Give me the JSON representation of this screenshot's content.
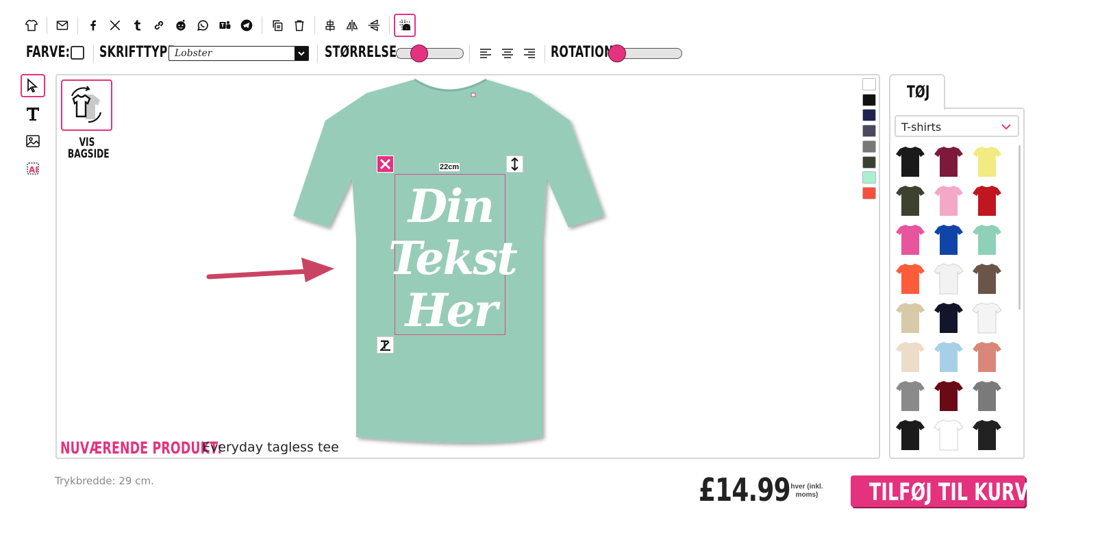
{
  "toolbar_top": {
    "icons": [
      "tshirt-icon",
      "mail-icon",
      "facebook-icon",
      "x-icon",
      "tumblr-icon",
      "pinterest-icon",
      "reddit-icon",
      "whatsapp-icon",
      "teams-icon",
      "telegram-icon",
      "copy-icon",
      "trash-icon",
      "align-center-icon",
      "flip-horizontal-icon",
      "flip-vertical-icon",
      "grid-helmet-icon"
    ]
  },
  "toolbar_format": {
    "color_label": "FARVE:",
    "font_label": "SKRIFTTYPE:",
    "font_value": "Lobster",
    "size_label": "STØRRELSE:",
    "size_value_fraction": 0.28,
    "rotation_label": "ROTATION:",
    "rotation_value_fraction": 0.0
  },
  "tools": [
    "pointer-icon",
    "text-icon",
    "image-icon",
    "ai-icon"
  ],
  "canvas": {
    "show_back_label_1": "VIS",
    "show_back_label_2": "BAGSIDE",
    "design_text_lines": [
      "Din",
      "Tekst",
      "Her"
    ],
    "dimension_label": "22cm",
    "current_product_label": "NUVÆRENDE PRODUKT:",
    "current_product_name": "Everyday tagless tee",
    "shirt_color": "#97ccb9",
    "swatches": [
      "#ffffff",
      "#111111",
      "#1f2150",
      "#4a4a5e",
      "#777777",
      "#3b4030",
      "#a8f0d0",
      "#f5503b"
    ]
  },
  "panel": {
    "tab_label": "TØJ",
    "category": "T-shirts",
    "thumbs": [
      "#1a1a1a",
      "#7d1a3c",
      "#f2ea82",
      "#3d4230",
      "#f4a8c8",
      "#c01620",
      "#e8549e",
      "#1144a8",
      "#8fd0b8",
      "#ff5d3a",
      "#f2f2f2",
      "#6b5548",
      "#d8c9a8",
      "#13162a",
      "#f4f4f4",
      "#ecdcc8",
      "#a8cfe8",
      "#d9877a",
      "#8a8a8a",
      "#6a0a14",
      "#7a7a7a",
      "#1b1b1b",
      "#ffffff",
      "#222222"
    ]
  },
  "footer": {
    "print_width": "Trykbredde: 29 cm.",
    "price": "£14.99",
    "price_note_1": "hver (inkl.",
    "price_note_2": "moms)",
    "add_to_cart": "TILFØJ TIL KURV"
  },
  "colors": {
    "accent": "#e4327e",
    "arrow": "#c94464"
  }
}
